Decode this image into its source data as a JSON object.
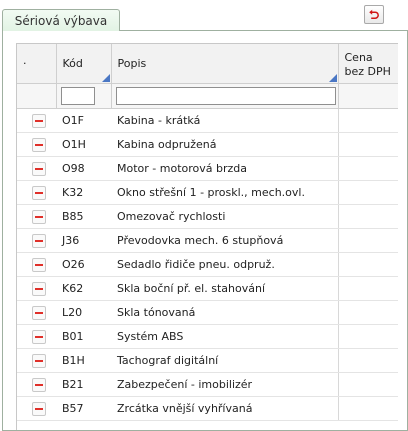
{
  "tab": {
    "label": "Sériová výbava"
  },
  "toolbar": {
    "undo_icon": "undo-icon",
    "accent_color": "#d01818"
  },
  "grid": {
    "columns": [
      {
        "key": "action",
        "label": "·"
      },
      {
        "key": "code",
        "label": "Kód"
      },
      {
        "key": "description",
        "label": "Popis"
      },
      {
        "key": "price",
        "label_line1": "Cena",
        "label_line2": "bez DPH"
      }
    ],
    "filters": {
      "code_value": "",
      "description_value": ""
    },
    "remove_icon": "minus-icon",
    "rows": [
      {
        "code": "O1F",
        "description": "Kabina - krátká",
        "price": ""
      },
      {
        "code": "O1H",
        "description": "Kabina odpružená",
        "price": ""
      },
      {
        "code": "O98",
        "description": "Motor - motorová brzda",
        "price": ""
      },
      {
        "code": "K32",
        "description": "Okno střešní 1 - proskl., mech.ovl.",
        "price": ""
      },
      {
        "code": "B85",
        "description": "Omezovač rychlosti",
        "price": ""
      },
      {
        "code": "J36",
        "description": "Převodovka mech. 6 stupňová",
        "price": ""
      },
      {
        "code": "O26",
        "description": "Sedadlo řidiče pneu. odpruž.",
        "price": ""
      },
      {
        "code": "K62",
        "description": "Skla boční př. el. stahování",
        "price": ""
      },
      {
        "code": "L20",
        "description": "Skla tónovaná",
        "price": ""
      },
      {
        "code": "B01",
        "description": "Systém ABS",
        "price": ""
      },
      {
        "code": "B1H",
        "description": "Tachograf digitální",
        "price": ""
      },
      {
        "code": "B21",
        "description": "Zabezpečení - imobilizér",
        "price": ""
      },
      {
        "code": "B57",
        "description": "Zrcátka vnější vyhřívaná",
        "price": ""
      }
    ]
  }
}
